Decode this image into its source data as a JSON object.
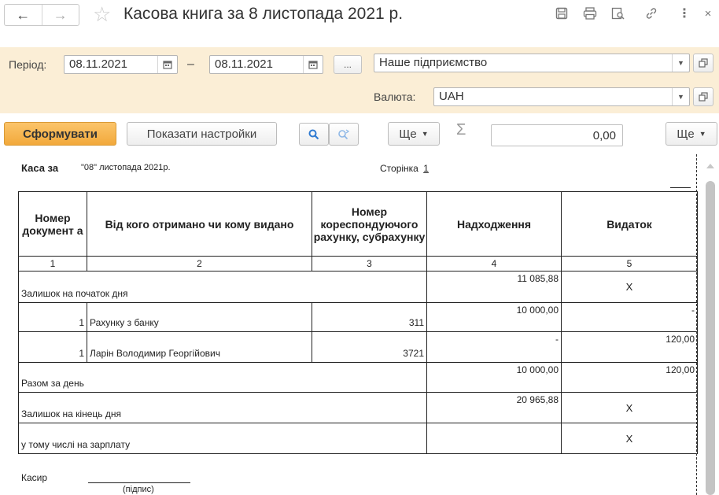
{
  "window": {
    "title": "Касова книга за 8 листопада 2021 р.",
    "nav": {
      "back_icon": "←",
      "forward_icon": "→"
    },
    "toolbar_icons": [
      "save-icon",
      "print-icon",
      "preview-icon",
      "link-icon",
      "more-icon",
      "close-icon"
    ]
  },
  "params": {
    "period_label": "Період:",
    "date_from": "08.11.2021",
    "date_to": "08.11.2021",
    "dash": "–",
    "ellipsis": "...",
    "organization": "Наше підприємство",
    "currency_label": "Валюта:",
    "currency": "UAH"
  },
  "commands": {
    "generate": "Сформувати",
    "show_settings": "Показати настройки",
    "more1": "Ще",
    "sum_value": "0,00",
    "more2": "Ще"
  },
  "report": {
    "kasa_label": "Каса за",
    "kasa_date": "\"08\" листопада 2021р.",
    "page_label": "Сторінка",
    "page_number": "1",
    "headers": {
      "c1": "Номер документ а",
      "c2": "Від кого отримано чи кому видано",
      "c3": "Номер кореспондуючого рахунку, субрахунку",
      "c4": "Надходження",
      "c5": "Видаток"
    },
    "col_numbers": [
      "1",
      "2",
      "3",
      "4",
      "5"
    ],
    "opening": {
      "label": "Залишок на початок дня",
      "income": "11 085,88",
      "expense": "X"
    },
    "rows": [
      {
        "num": "1",
        "who": "Рахунку з банку",
        "account": "311",
        "income": "10 000,00",
        "expense": "-"
      },
      {
        "num": "1",
        "who": "Ларін Володимир Георгійович",
        "account": "3721",
        "income": "-",
        "expense": "120,00"
      }
    ],
    "total": {
      "label": "Разом за день",
      "income": "10 000,00",
      "expense": "120,00"
    },
    "closing": {
      "label": "Залишок на кінець дня",
      "income": "20 965,88",
      "expense": "X"
    },
    "salary": {
      "label": "у тому числі на зарплату",
      "income": "",
      "expense": "X"
    },
    "cashier_label": "Касир",
    "signature_label": "(підпис)"
  }
}
